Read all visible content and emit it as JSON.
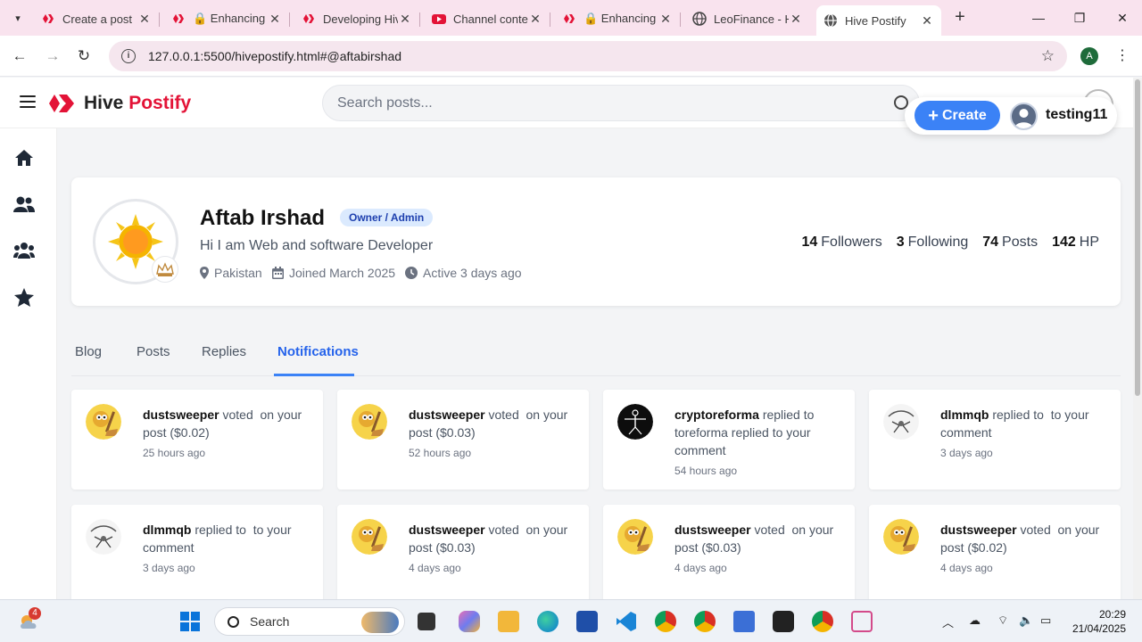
{
  "browser": {
    "tabs": [
      {
        "title": "Create a post",
        "favicon": "hive-icon"
      },
      {
        "title": "🔒 Enhancing Hive",
        "favicon": "hive-icon"
      },
      {
        "title": "Developing Hive",
        "favicon": "hive-icon"
      },
      {
        "title": "Channel content",
        "favicon": "youtube-icon"
      },
      {
        "title": "🔒 Enhancing Hive",
        "favicon": "hive-icon"
      },
      {
        "title": "LeoFinance - Hive",
        "favicon": "globe-icon"
      },
      {
        "title": "Hive Postify",
        "favicon": "globe-icon"
      }
    ],
    "url": "127.0.0.1:5500/hivepostify.html#@aftabirshad",
    "profile_initial": "A"
  },
  "app": {
    "brand_part1": "Hive",
    "brand_part2": "Postify",
    "search_placeholder": "Search posts...",
    "create_label": "Create",
    "username": "testing11",
    "accent": "#3b82f6",
    "brand_color": "#e31337"
  },
  "profile": {
    "name": "Aftab Irshad",
    "role_badge": "Owner / Admin",
    "bio": "Hi I am Web and software Developer",
    "location": "Pakistan",
    "joined": "Joined March 2025",
    "active": "Active 3 days ago",
    "stats": {
      "followers_count": "14",
      "followers_label": "Followers",
      "following_count": "3",
      "following_label": "Following",
      "posts_count": "74",
      "posts_label": "Posts",
      "hp_count": "142",
      "hp_label": "HP"
    }
  },
  "tabs": [
    "Blog",
    "Posts",
    "Replies",
    "Notifications"
  ],
  "notifications": [
    {
      "user": "dustsweeper",
      "text": "voted  on your post ($0.02)",
      "time": "25 hours ago",
      "avatar": "broom-mascot"
    },
    {
      "user": "dustsweeper",
      "text": "voted  on your post ($0.03)",
      "time": "52 hours ago",
      "avatar": "broom-mascot"
    },
    {
      "user": "cryptoreforma",
      "text": "replied to  toreforma replied to your comment",
      "time": "54 hours ago",
      "avatar": "vitruvian"
    },
    {
      "user": "dlmmqb",
      "text": "replied to  to your comment",
      "time": "3 days ago",
      "avatar": "sketch"
    },
    {
      "user": "dlmmqb",
      "text": "replied to  to your comment",
      "time": "3 days ago",
      "avatar": "sketch"
    },
    {
      "user": "dustsweeper",
      "text": "voted  on your post ($0.03)",
      "time": "4 days ago",
      "avatar": "broom-mascot"
    },
    {
      "user": "dustsweeper",
      "text": "voted  on your post ($0.03)",
      "time": "4 days ago",
      "avatar": "broom-mascot"
    },
    {
      "user": "dustsweeper",
      "text": "voted  on your post ($0.02)",
      "time": "4 days ago",
      "avatar": "broom-mascot"
    }
  ],
  "taskbar": {
    "search_label": "Search",
    "time": "20:29",
    "date": "21/04/2025",
    "weather_badge": "4"
  }
}
